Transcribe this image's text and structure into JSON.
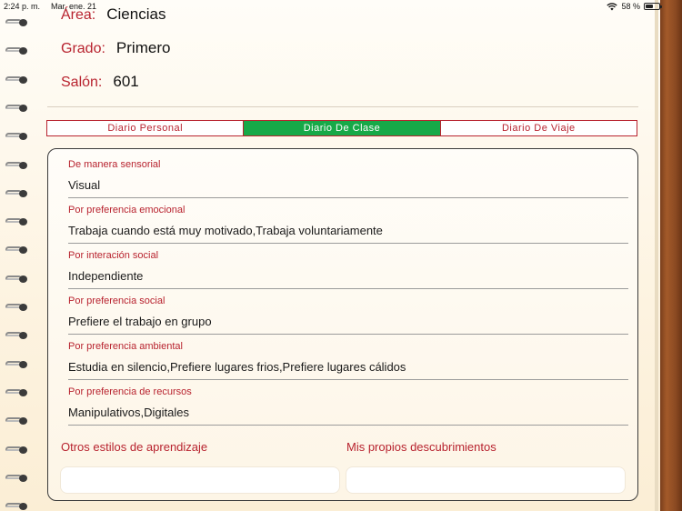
{
  "status_bar": {
    "time": "2:24 p. m.",
    "date": "Mar. ene. 21",
    "battery": "58 %",
    "battery_level": 0.58
  },
  "header": {
    "area_label": "Área:",
    "area_value": "Ciencias",
    "grade_label": "Grado:",
    "grade_value": "Primero",
    "room_label": "Salón:",
    "room_value": "601"
  },
  "tabs": [
    {
      "label": "Diario Personal",
      "active": false
    },
    {
      "label": "Diario De Clase",
      "active": true
    },
    {
      "label": "Diario De Viaje",
      "active": false
    }
  ],
  "fields": [
    {
      "label": "De manera sensorial",
      "value": "Visual"
    },
    {
      "label": "Por preferencia emocional",
      "value": "Trabaja cuando está muy motivado,Trabaja voluntariamente"
    },
    {
      "label": "Por interación social",
      "value": "Independiente"
    },
    {
      "label": "Por preferencia social",
      "value": "Prefiere el trabajo en grupo"
    },
    {
      "label": "Por preferencia ambiental",
      "value": "Estudia en silencio,Prefiere lugares frios,Prefiere lugares cálidos"
    },
    {
      "label": "Por preferencia de recursos",
      "value": "Manipulativos,Digitales"
    }
  ],
  "other_styles": {
    "label": "Otros estilos de aprendizaje",
    "value": ""
  },
  "discoveries": {
    "label": "Mis propios descubrimientos",
    "value": ""
  },
  "colors": {
    "accent_red": "#b8232f",
    "active_tab_green": "#17a948",
    "binder_brown": "#8b4a22"
  }
}
